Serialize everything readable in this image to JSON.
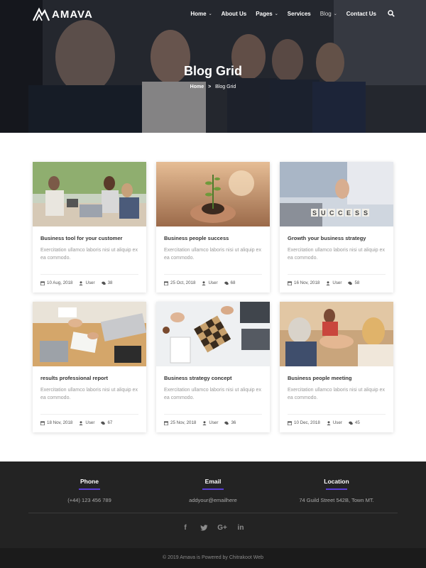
{
  "brand": {
    "name": "AMAVA"
  },
  "nav": {
    "items": [
      {
        "label": "Home",
        "dropdown": true
      },
      {
        "label": "About Us",
        "dropdown": false
      },
      {
        "label": "Pages",
        "dropdown": true
      },
      {
        "label": "Services",
        "dropdown": false
      },
      {
        "label": "Blog",
        "dropdown": true
      },
      {
        "label": "Contact Us",
        "dropdown": false
      }
    ],
    "search_icon": "search-icon"
  },
  "hero": {
    "title": "Blog Grid",
    "breadcrumb": {
      "home": "Home",
      "separator": ">",
      "current": "Blog Grid"
    }
  },
  "posts": [
    {
      "title": "Business tool for your customer",
      "excerpt": "Exercitation ullamco laboris nisi ut aliquip ex ea commodo.",
      "date": "10 Aug, 2018",
      "author": "User",
      "comments": "38"
    },
    {
      "title": "Business people success",
      "excerpt": "Exercitation ullamco laboris nisi ut aliquip ex ea commodo.",
      "date": "25 Oct, 2018",
      "author": "User",
      "comments": "68"
    },
    {
      "title": "Growth your business strategy",
      "excerpt": "Exercitation ullamco laboris nisi ut aliquip ex ea commodo.",
      "date": "16 Nov, 2018",
      "author": "User",
      "comments": "58"
    },
    {
      "title": "results professional report",
      "excerpt": "Exercitation ullamco laboris nisi ut aliquip ex ea commodo.",
      "date": "18 Nov, 2018",
      "author": "User",
      "comments": "67"
    },
    {
      "title": "Business strategy concept",
      "excerpt": "Exercitation ullamco laboris nisi ut aliquip ex ea commodo.",
      "date": "25 Nov, 2018",
      "author": "User",
      "comments": "36"
    },
    {
      "title": "Business people meeting",
      "excerpt": "Exercitation ullamco laboris nisi ut aliquip ex ea commodo.",
      "date": "10 Dec, 2018",
      "author": "User",
      "comments": "45"
    }
  ],
  "footer": {
    "phone": {
      "heading": "Phone",
      "value": "(+44) 123 456 789"
    },
    "email": {
      "heading": "Email",
      "value": "addyour@emailhere"
    },
    "location": {
      "heading": "Location",
      "value": "74 Guild Street 542B, Town MT."
    },
    "social": [
      "facebook-icon",
      "twitter-icon",
      "google-plus-icon",
      "linkedin-icon"
    ],
    "copyright": "© 2019 Amava is Powered by Chitrakoot Web"
  },
  "colors": {
    "accent": "#5b3fd6",
    "footer_bg": "#232323",
    "copy_bg": "#1b1b1b"
  }
}
